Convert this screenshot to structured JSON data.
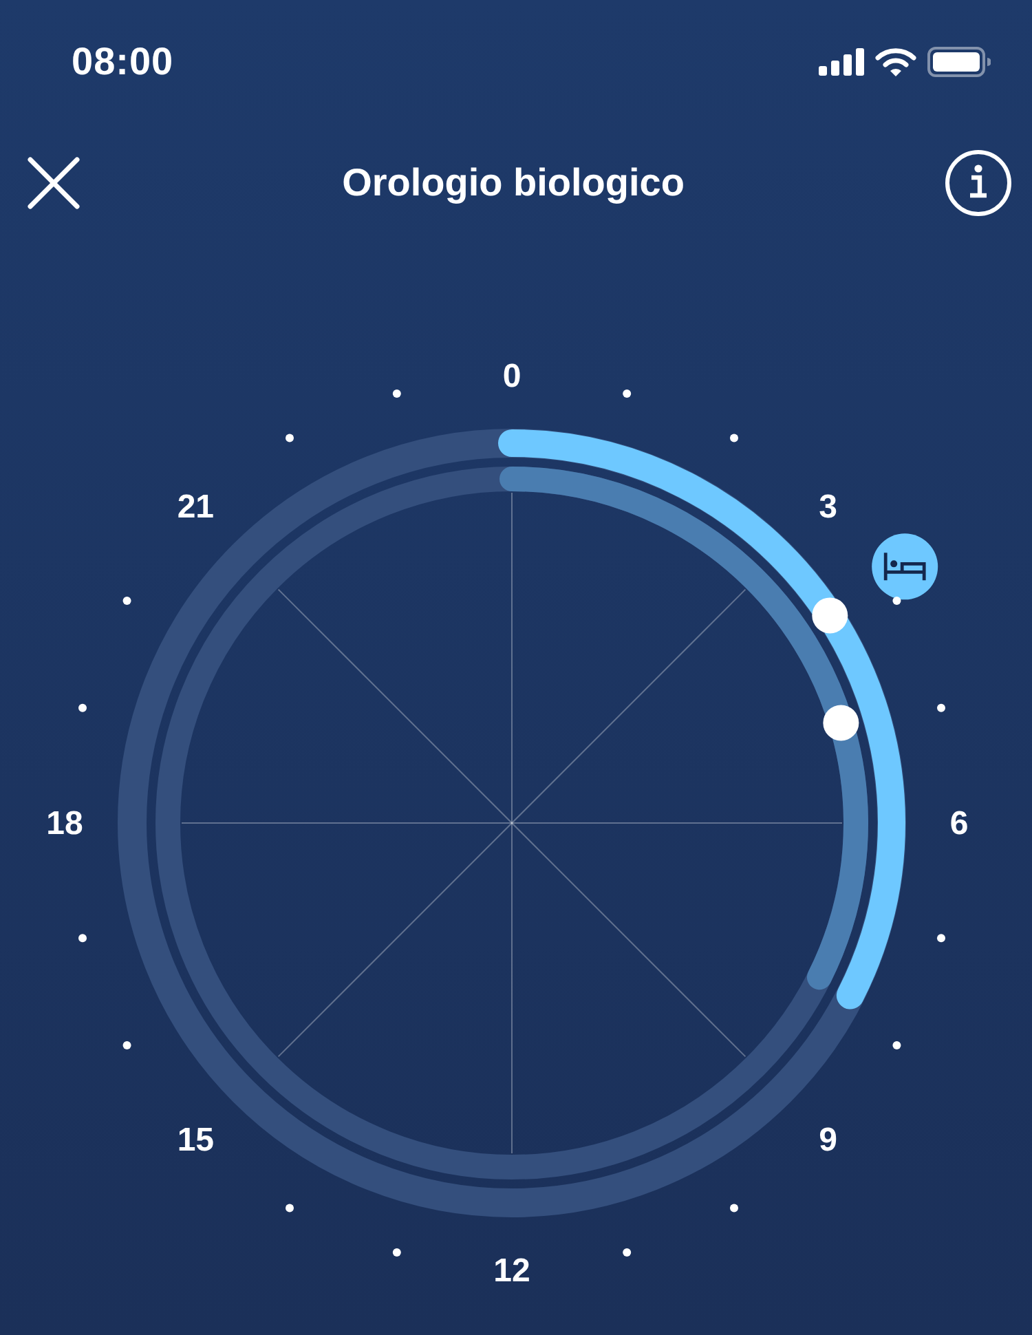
{
  "status_bar": {
    "time": "08:00"
  },
  "header": {
    "title": "Orologio biologico"
  },
  "dial": {
    "hour_labels": [
      "0",
      "3",
      "6",
      "9",
      "12",
      "15",
      "18",
      "21"
    ]
  }
}
